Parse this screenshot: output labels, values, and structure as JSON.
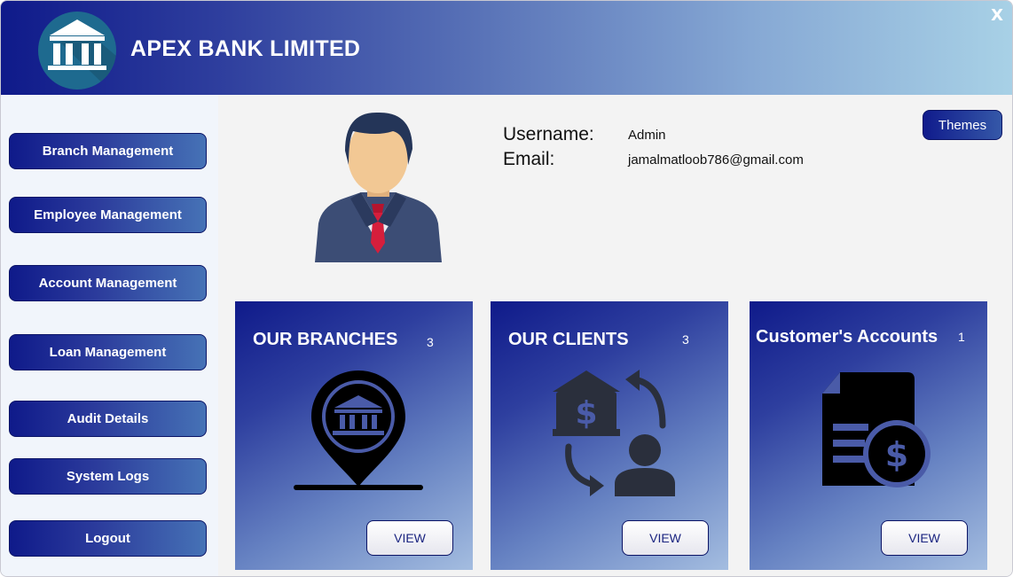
{
  "app": {
    "title": "APEX BANK LIMITED",
    "close_label": "X"
  },
  "sidebar": {
    "items": [
      {
        "label": "Branch Management"
      },
      {
        "label": "Employee Management"
      },
      {
        "label": "Account Management"
      },
      {
        "label": "Loan Management"
      },
      {
        "label": "Audit Details"
      },
      {
        "label": "System Logs"
      },
      {
        "label": "Logout"
      }
    ]
  },
  "profile": {
    "username_label": "Username:",
    "username_value": "Admin",
    "email_label": "Email:",
    "email_value": "jamalmatloob786@gmail.com"
  },
  "toolbar": {
    "themes_label": "Themes"
  },
  "cards": [
    {
      "title": "OUR BRANCHES",
      "count": "3",
      "view_label": "VIEW",
      "icon": "branch-location-icon"
    },
    {
      "title": "OUR CLIENTS",
      "count": "3",
      "view_label": "VIEW",
      "icon": "client-exchange-icon"
    },
    {
      "title": "Customer's Accounts",
      "count": "1",
      "view_label": "VIEW",
      "icon": "account-document-icon"
    }
  ],
  "colors": {
    "header_start": "#0f1a8a",
    "header_end": "#a8d1e6",
    "accent": "#1a2480",
    "sidebar_bg": "#f1f5fb"
  }
}
